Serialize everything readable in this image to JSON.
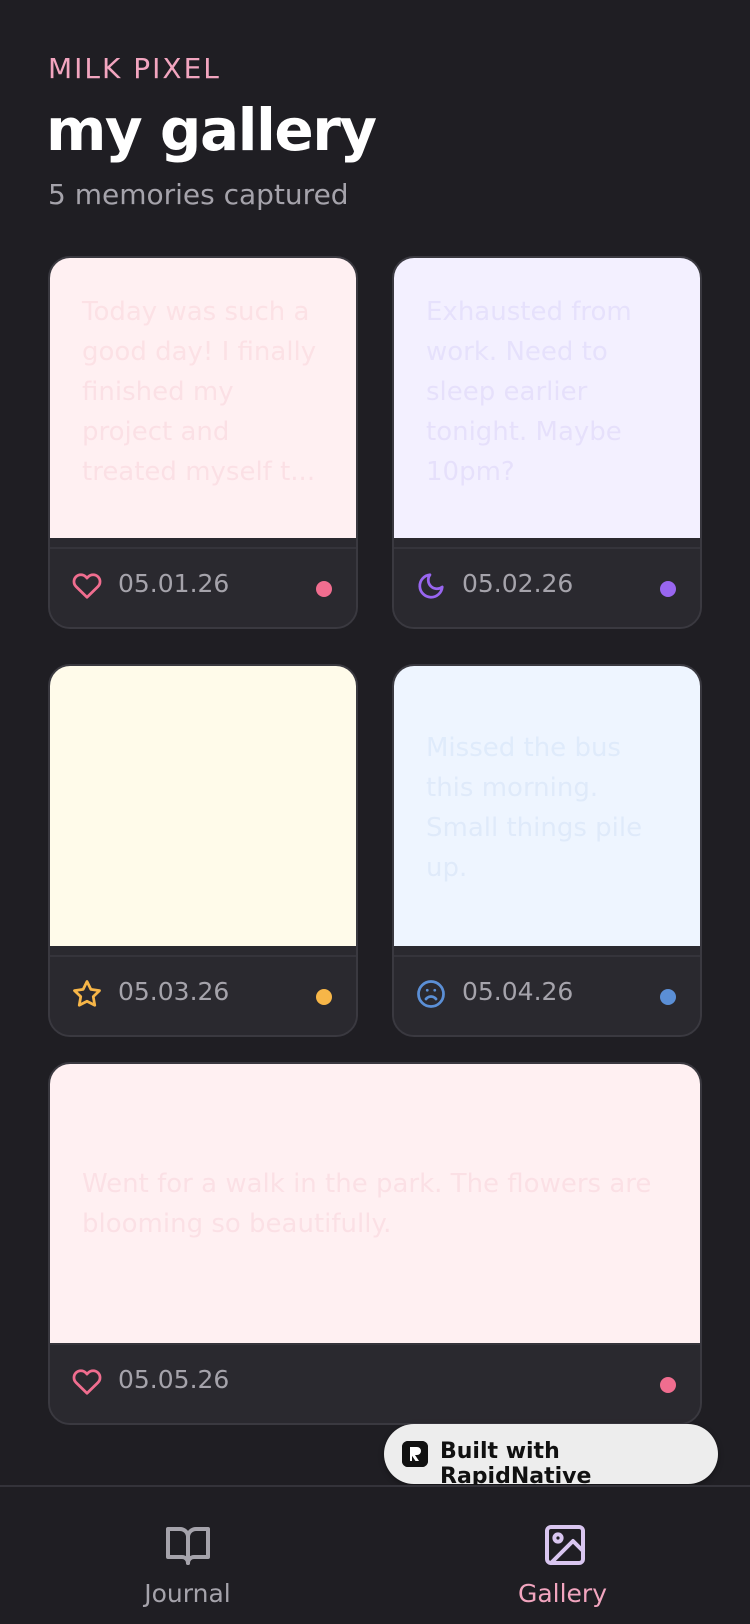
{
  "header": {
    "brand": "MILK PIXEL",
    "title": "my gallery",
    "subtitle": "5 memories captured"
  },
  "cards": [
    {
      "text": "Today was such a good day! I finally finished my project and treated myself t...",
      "date": "05.01.26",
      "mood_icon": "heart-icon",
      "accent": "#f06d8f",
      "bg": "#fff0f2"
    },
    {
      "text": "Exhausted from work. Need to sleep earlier tonight. Maybe 10pm?",
      "date": "05.02.26",
      "mood_icon": "moon-icon",
      "accent": "#9966f0",
      "bg": "#f3f0ff"
    },
    {
      "text": "",
      "date": "05.03.26",
      "mood_icon": "star-icon",
      "accent": "#f7b648",
      "bg": "#fffbea"
    },
    {
      "text": "Missed the bus this morning. Small things pile up.",
      "date": "05.04.26",
      "mood_icon": "sad-face-icon",
      "accent": "#5b8fd6",
      "bg": "#eef5ff"
    },
    {
      "text": "Went for a walk in the park. The flowers are blooming so beautifully.",
      "date": "05.05.26",
      "mood_icon": "heart-icon",
      "accent": "#f06d8f",
      "bg": "#fff0f2"
    }
  ],
  "badge": {
    "label": "Built with RapidNative"
  },
  "tabbar": {
    "tabs": [
      {
        "label": "Journal",
        "icon": "book-icon",
        "active": false,
        "color": "#a5a3ab"
      },
      {
        "label": "Gallery",
        "icon": "image-icon",
        "active": true,
        "color": "#f2a5bf"
      }
    ]
  }
}
